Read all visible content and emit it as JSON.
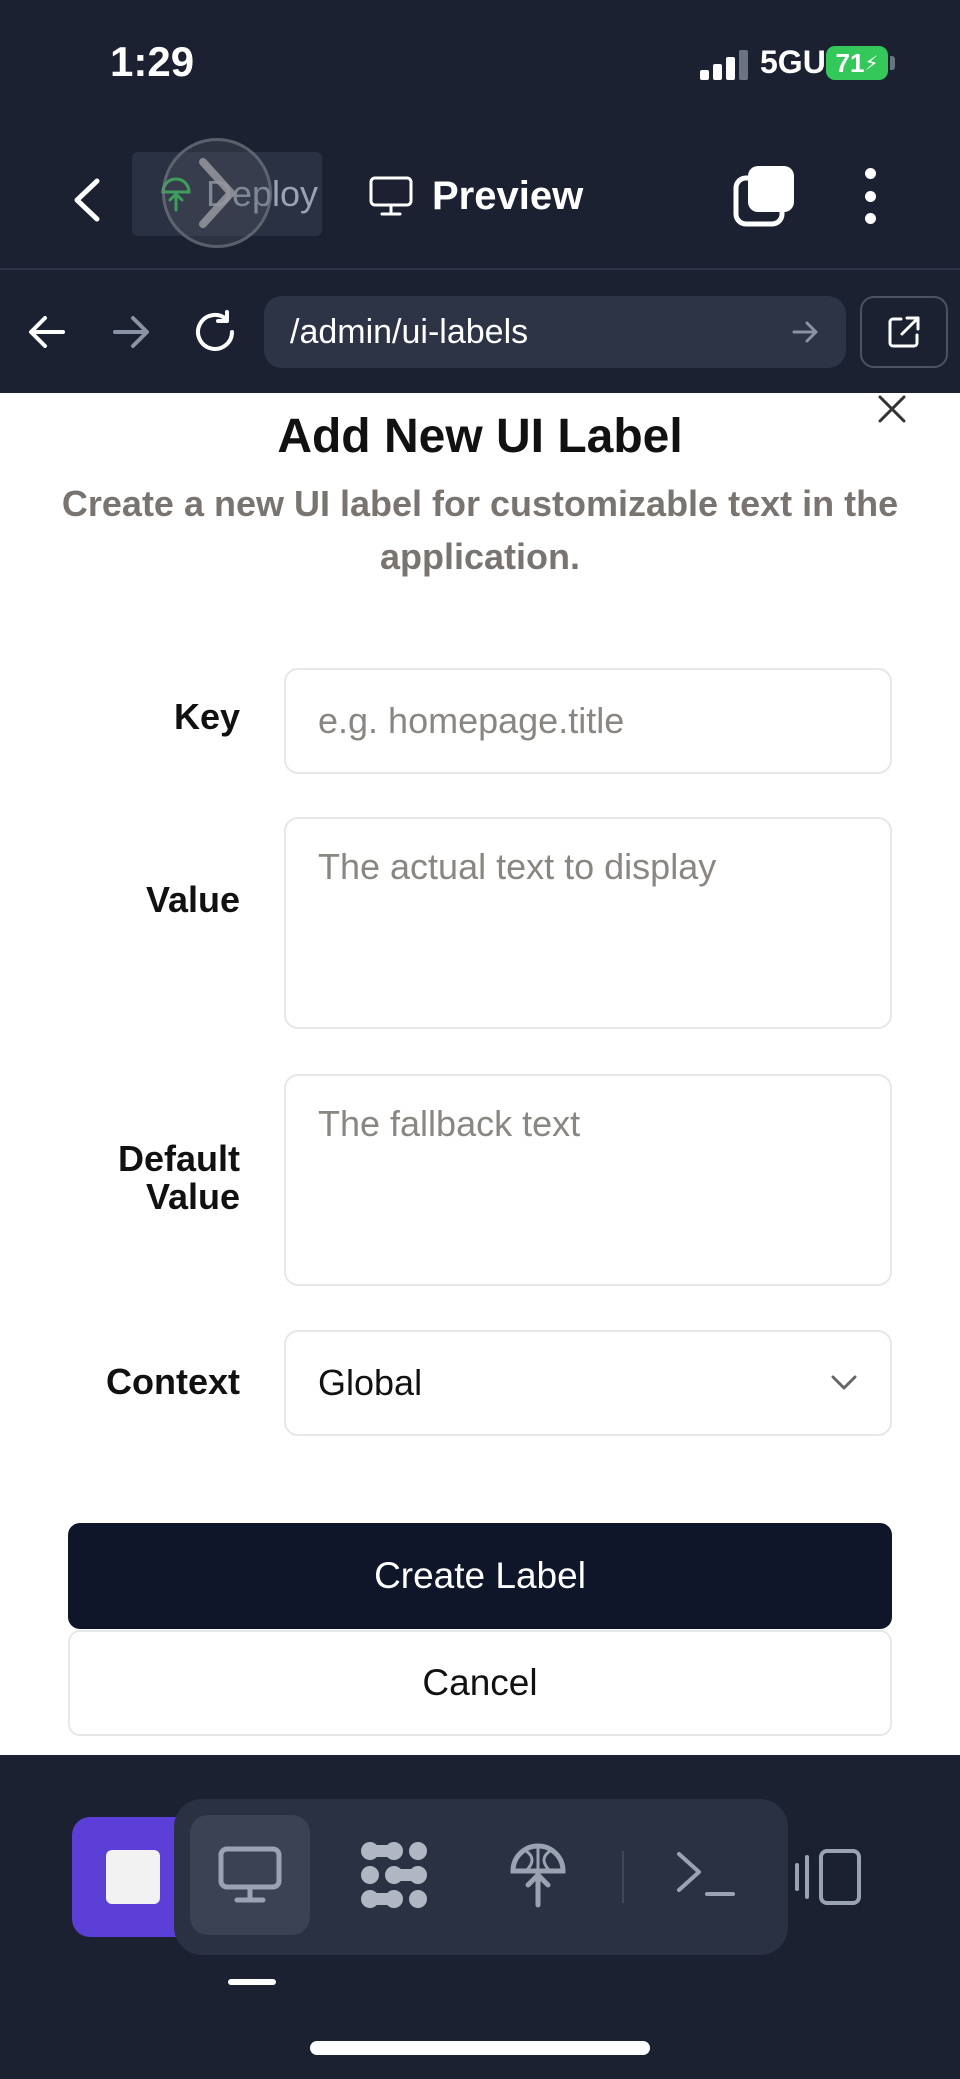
{
  "status_bar": {
    "time": "1:29",
    "network": "5GUC",
    "battery": "71"
  },
  "toolbar": {
    "deploy_label": "Deploy",
    "preview_label": "Preview"
  },
  "browser": {
    "url": "/admin/ui-labels"
  },
  "modal": {
    "title": "Add New UI Label",
    "description": "Create a new UI label for customizable text in the application.",
    "fields": {
      "key": {
        "label": "Key",
        "placeholder": "e.g. homepage.title"
      },
      "value": {
        "label": "Value",
        "placeholder": "The actual text to display"
      },
      "default_value": {
        "label": "Default Value",
        "placeholder": "The fallback text"
      },
      "context": {
        "label": "Context",
        "selected": "Global"
      }
    },
    "create_button": "Create Label",
    "cancel_button": "Cancel"
  },
  "colors": {
    "app_background": "#1b2131",
    "primary_button": "#0f1629",
    "stop_button": "#5b3fd6",
    "placeholder_text": "#8a8682",
    "deploy_icon": "#34c759"
  },
  "icons": {
    "toolbar": [
      "chevron-left-icon",
      "deploy-icon",
      "monitor-icon",
      "tabs-icon",
      "more-vertical-icon"
    ],
    "browser": [
      "arrow-left-icon",
      "arrow-right-icon",
      "refresh-icon",
      "arrow-right-icon",
      "external-link-icon"
    ],
    "bottom": [
      "stop-icon",
      "monitor-icon",
      "apps-grid-icon",
      "deploy-icon",
      "terminal-icon",
      "device-panel-icon"
    ]
  }
}
